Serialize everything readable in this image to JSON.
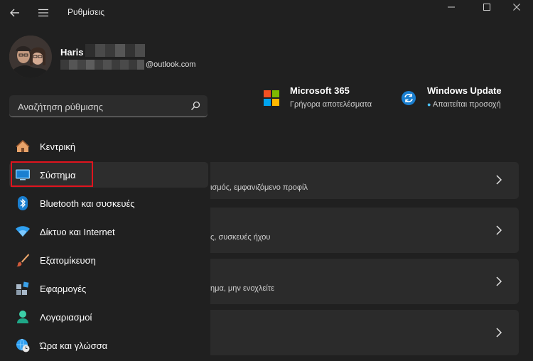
{
  "window": {
    "title": "Ρυθμίσεις"
  },
  "profile": {
    "name": "Haris",
    "email_suffix": "@outlook.com"
  },
  "search": {
    "placeholder": "Αναζήτηση ρύθμισης"
  },
  "nav": {
    "items": [
      {
        "label": "Κεντρική",
        "icon": "home-icon"
      },
      {
        "label": "Σύστημα",
        "icon": "system-icon",
        "selected": true
      },
      {
        "label": "Bluetooth και συσκευές",
        "icon": "bluetooth-icon"
      },
      {
        "label": "Δίκτυο και Internet",
        "icon": "wifi-icon"
      },
      {
        "label": "Εξατομίκευση",
        "icon": "brush-icon"
      },
      {
        "label": "Εφαρμογές",
        "icon": "apps-icon"
      },
      {
        "label": "Λογαριασμοί",
        "icon": "account-icon"
      },
      {
        "label": "Ώρα και γλώσσα",
        "icon": "globe-clock-icon"
      }
    ]
  },
  "top_cards": {
    "microsoft365": {
      "title": "Microsoft 365",
      "subtitle": "Γρήγορα αποτελέσματα"
    },
    "windows_update": {
      "title": "Windows Update",
      "subtitle": "Απαιτείται προσοχή"
    }
  },
  "cards": [
    {
      "description": "ισμός, εμφανιζόμενο προφίλ"
    },
    {
      "description": "ς, συσκευές ήχου"
    },
    {
      "description": "ημα, μην ενοχλείτε"
    },
    {
      "description": ""
    }
  ],
  "colors": {
    "background": "#202020",
    "accent": "#4cc2ff",
    "highlight": "#e0141e"
  }
}
